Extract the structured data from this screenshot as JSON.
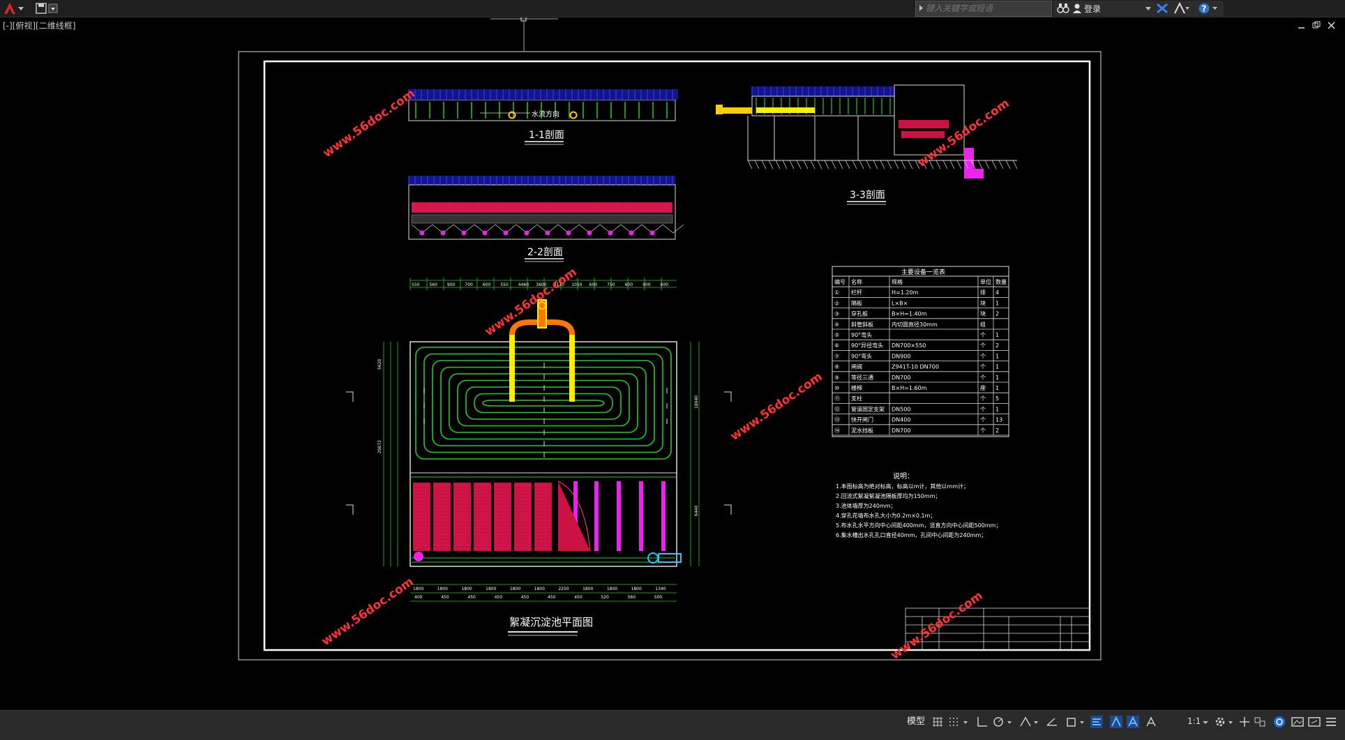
{
  "topbar": {
    "search_placeholder": "键入关键字或短语",
    "login_label": "登录"
  },
  "viewport": {
    "label": "[-][俯视][二维线框]"
  },
  "drawing": {
    "section_1": "1-1剖面",
    "section_2": "2-2剖面",
    "section_3": "3-3剖面",
    "plan_title": "絮凝沉淀池平面图",
    "flow_dir": "水流方向",
    "watermark": "www.56doc.com",
    "equip_table": {
      "title": "主要设备一览表",
      "headers": [
        "编号",
        "名称",
        "规格",
        "单位",
        "数量"
      ],
      "rows": [
        [
          "①",
          "栏杆",
          "H=1.20m",
          "排",
          "4"
        ],
        [
          "②",
          "隔板",
          "L×B×",
          "块",
          "1"
        ],
        [
          "③",
          "穿孔板",
          "B×H=1.40m",
          "块",
          "2"
        ],
        [
          "④",
          "斜管斜板",
          "内切圆直径30mm",
          "组",
          ""
        ],
        [
          "⑤",
          "90°弯头",
          "",
          "个",
          "1"
        ],
        [
          "⑥",
          "90°异径弯头",
          "DN700×550",
          "个",
          "2"
        ],
        [
          "⑦",
          "90°弯头",
          "DN900",
          "个",
          "1"
        ],
        [
          "⑧",
          "闸阀",
          "Z941T-10 DN700",
          "个",
          "1"
        ],
        [
          "⑨",
          "等径三通",
          "DN700",
          "个",
          "1"
        ],
        [
          "⑩",
          "楼梯",
          "B×H=1.60m",
          "座",
          "1"
        ],
        [
          "⑪",
          "支柱",
          "",
          "个",
          "5"
        ],
        [
          "⑫",
          "管道固定支架",
          "DN500",
          "个",
          "1"
        ],
        [
          "⑬",
          "快开闸门",
          "DN400",
          "个",
          "13"
        ],
        [
          "⑭",
          "泥水挡板",
          "DN700",
          "个",
          "2"
        ]
      ]
    },
    "notes": {
      "title": "说明：",
      "lines": [
        "1.本图标高为绝对标高，标高以m计，其他以mm计；",
        "2.回流式絮凝絮凝池隔板厚均为150mm；",
        "3.池体墙厚为240mm；",
        "4.穿孔花墙布水孔大小为0.2m×0.1m；",
        "5.布水孔水平方向中心间距400mm，竖直方向中心间距500mm；",
        "6.集水槽出水孔孔口直径40mm，孔间中心间距为240mm；"
      ]
    },
    "dims_top": [
      "550",
      "560",
      "900",
      "700",
      "600",
      "550",
      "4460",
      "3600",
      "3110",
      "1050",
      "600",
      "750",
      "600",
      "900",
      "600"
    ],
    "dims_bottom": [
      "1800",
      "1800",
      "1800",
      "1800",
      "1800",
      "1800",
      "2250",
      "1800",
      "1800",
      "1800",
      "1340"
    ],
    "dims_bottom2": [
      "400",
      "450",
      "450",
      "450",
      "450",
      "450",
      "450",
      "520",
      "560",
      "500"
    ],
    "dims_side": [
      "18040",
      "6440",
      "29072",
      "5620"
    ]
  },
  "statusbar": {
    "model_label": "模型",
    "scale_label": "1:1"
  },
  "colors": {
    "bg": "#000000",
    "frame": "#ffffff",
    "green": "#22cc22",
    "red": "#cc1144",
    "magenta": "#ee22ee",
    "yellow": "#ffee00",
    "blue": "#2222cc",
    "cyan": "#22ccff",
    "watermark": "#ff3333"
  }
}
